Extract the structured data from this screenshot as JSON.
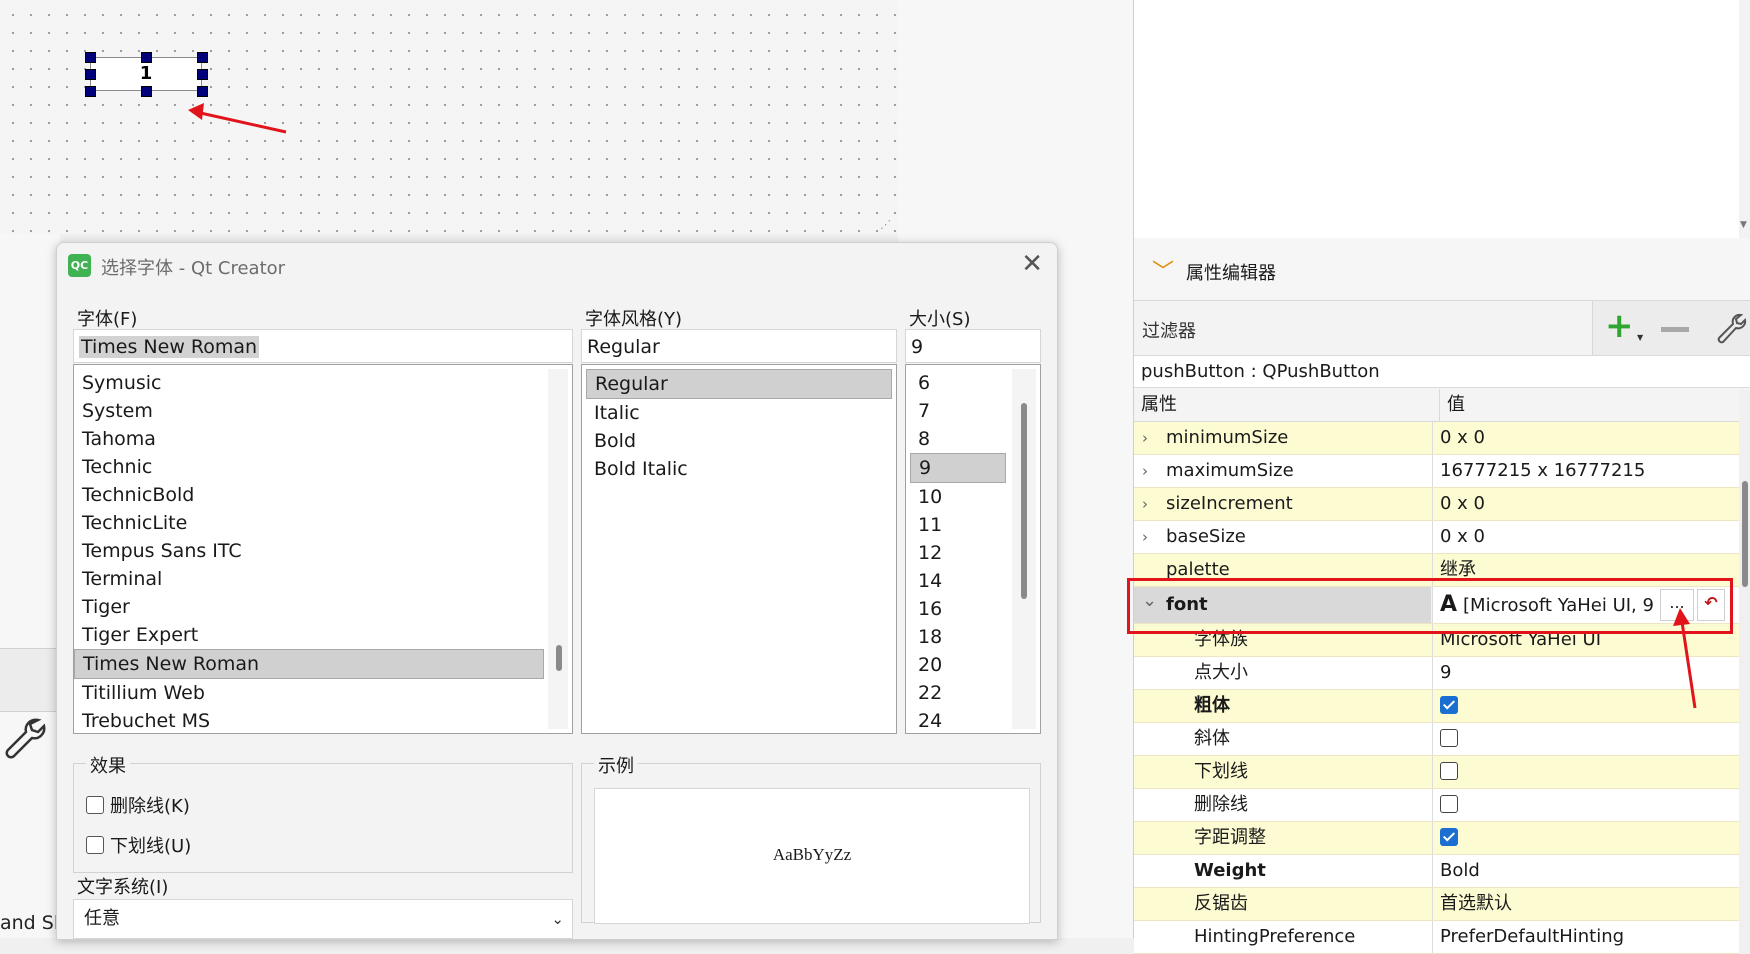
{
  "canvas": {
    "widget_text": "1"
  },
  "left_panel": {
    "status_text": "and Sl"
  },
  "dialog": {
    "logo_text": "QC",
    "title": "选择字体 - Qt Creator",
    "family_label": "字体(F)",
    "family_value": "Times New Roman",
    "style_label": "字体风格(Y)",
    "style_value": "Regular",
    "size_label": "大小(S)",
    "size_value": "9",
    "families": [
      "Symusic",
      "System",
      "Tahoma",
      "Technic",
      "TechnicBold",
      "TechnicLite",
      "Tempus Sans ITC",
      "Terminal",
      "Tiger",
      "Tiger Expert",
      "Times New Roman",
      "Titillium Web",
      "Trebuchet MS"
    ],
    "selected_family": "Times New Roman",
    "styles": [
      "Regular",
      "Italic",
      "Bold",
      "Bold Italic"
    ],
    "selected_style": "Regular",
    "sizes": [
      "6",
      "7",
      "8",
      "9",
      "10",
      "11",
      "12",
      "14",
      "16",
      "18",
      "20",
      "22",
      "24"
    ],
    "selected_size": "9",
    "effects_title": "效果",
    "strikeout_label": "删除线(K)",
    "underline_label": "下划线(U)",
    "sample_title": "示例",
    "sample_text": "AaBbYyZz",
    "writing_system_label": "文字系统(I)",
    "writing_system_value": "任意"
  },
  "property_editor": {
    "title": "属性编辑器",
    "filter_label": "过滤器",
    "object": "pushButton : QPushButton",
    "col_property": "属性",
    "col_value": "值",
    "rows": [
      {
        "name": "minimumSize",
        "value": "0 x 0",
        "expandable": true,
        "indent": 0,
        "bold": false,
        "yellow": true
      },
      {
        "name": "maximumSize",
        "value": "16777215 x 16777215",
        "expandable": true,
        "indent": 0,
        "bold": false,
        "yellow": false
      },
      {
        "name": "sizeIncrement",
        "value": "0 x 0",
        "expandable": true,
        "indent": 0,
        "bold": false,
        "yellow": true
      },
      {
        "name": "baseSize",
        "value": "0 x 0",
        "expandable": true,
        "indent": 0,
        "bold": false,
        "yellow": false
      },
      {
        "name": "palette",
        "value": "继承",
        "expandable": false,
        "indent": 0,
        "bold": false,
        "yellow": true
      },
      {
        "name": "font",
        "value": "[Microsoft YaHei UI, 9",
        "expandable": true,
        "expanded": true,
        "indent": 0,
        "bold": true,
        "yellow": false,
        "font_row": true
      },
      {
        "name": "字体族",
        "value": "Microsoft YaHei UI",
        "indent": 1,
        "bold": false,
        "yellow": true
      },
      {
        "name": "点大小",
        "value": "9",
        "indent": 1,
        "bold": false,
        "yellow": false
      },
      {
        "name": "粗体",
        "check": true,
        "indent": 1,
        "bold": true,
        "yellow": true
      },
      {
        "name": "斜体",
        "check": false,
        "indent": 1,
        "bold": false,
        "yellow": false
      },
      {
        "name": "下划线",
        "check": false,
        "indent": 1,
        "bold": false,
        "yellow": true
      },
      {
        "name": "删除线",
        "check": false,
        "indent": 1,
        "bold": false,
        "yellow": false
      },
      {
        "name": "字距调整",
        "check": true,
        "indent": 1,
        "bold": false,
        "yellow": true
      },
      {
        "name": "Weight",
        "value": "Bold",
        "indent": 1,
        "bold": true,
        "yellow": false
      },
      {
        "name": "反锯齿",
        "value": "首选默认",
        "indent": 1,
        "bold": false,
        "yellow": true
      },
      {
        "name": "HintingPreference",
        "value": "PreferDefaultHinting",
        "indent": 1,
        "bold": false,
        "yellow": false
      }
    ],
    "font_more_label": "...",
    "font_glyph": "A"
  },
  "colors": {
    "yellow_row": "#fdfbd2",
    "white_row": "#ffffff",
    "highlight": "#e0141a",
    "arrow": "#e0141a",
    "checkbox_on": "#1a6fd0",
    "accent_chevron": "#e08a00",
    "plus": "#2fa62f",
    "logo": "#41b253"
  }
}
